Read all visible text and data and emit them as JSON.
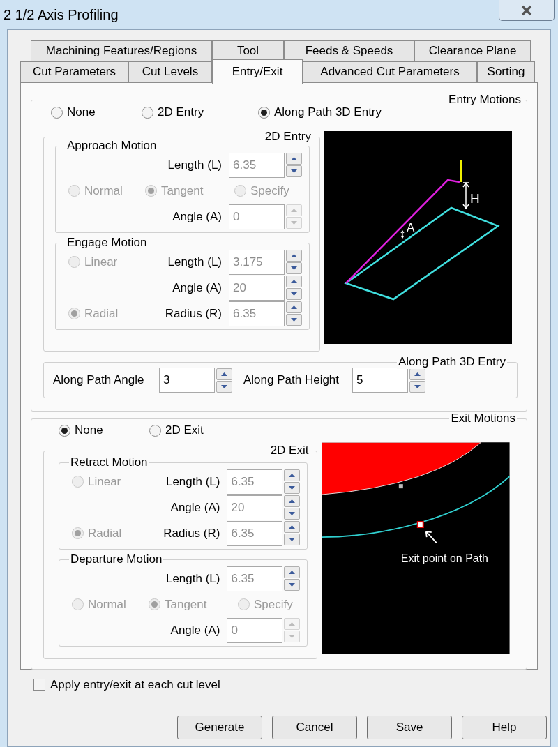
{
  "window": {
    "title": "2 1/2 Axis Profiling"
  },
  "tab_rows": [
    [
      {
        "label": "Machining Features/Regions",
        "selected": false
      },
      {
        "label": "Tool",
        "selected": false
      },
      {
        "label": "Feeds & Speeds",
        "selected": false
      },
      {
        "label": "Clearance Plane",
        "selected": false
      }
    ],
    [
      {
        "label": "Cut Parameters",
        "selected": false
      },
      {
        "label": "Cut Levels",
        "selected": false
      },
      {
        "label": "Entry/Exit",
        "selected": true
      },
      {
        "label": "Advanced Cut Parameters",
        "selected": false
      },
      {
        "label": "Sorting",
        "selected": false
      }
    ]
  ],
  "entry_motions": {
    "title": "Entry Motions",
    "options": [
      {
        "label": "None",
        "selected": false
      },
      {
        "label": "2D Entry",
        "selected": false
      },
      {
        "label": "Along Path 3D Entry",
        "selected": true
      }
    ],
    "entry_2d": {
      "title": "2D Entry",
      "disabled": true,
      "groups": [
        {
          "title": "Approach Motion",
          "rows": [
            {
              "kind": "field",
              "label": "Length (L)",
              "value": "6.35",
              "spin_disabled": false
            },
            {
              "kind": "radios",
              "options": [
                {
                  "label": "Normal",
                  "selected": false
                },
                {
                  "label": "Tangent",
                  "selected": true
                },
                {
                  "label": "Specify",
                  "selected": false
                }
              ]
            },
            {
              "kind": "field",
              "label": "Angle (A)",
              "value": "0",
              "spin_disabled": true
            }
          ]
        },
        {
          "title": "Engage Motion",
          "rows": [
            {
              "kind": "field",
              "radio": {
                "label": "Linear",
                "selected": false
              },
              "label": "Length (L)",
              "value": "3.175",
              "spin_disabled": false
            },
            {
              "kind": "field",
              "label": "Angle (A)",
              "value": "20",
              "spin_disabled": false
            },
            {
              "kind": "field",
              "radio": {
                "label": "Radial",
                "selected": true
              },
              "label": "Radius (R)",
              "value": "6.35",
              "spin_disabled": false
            }
          ]
        }
      ]
    },
    "diagram": {
      "height_label": "H",
      "angle_label": "A"
    },
    "along_path": {
      "title": "Along Path 3D Entry",
      "fields": [
        {
          "label": "Along Path Angle",
          "value": "3"
        },
        {
          "label": "Along Path Height",
          "value": "5"
        }
      ]
    }
  },
  "exit_motions": {
    "title": "Exit Motions",
    "options": [
      {
        "label": "None",
        "selected": true
      },
      {
        "label": "2D Exit",
        "selected": false
      }
    ],
    "exit_2d": {
      "title": "2D Exit",
      "disabled": true,
      "groups": [
        {
          "title": "Retract Motion",
          "rows": [
            {
              "kind": "field",
              "radio": {
                "label": "Linear",
                "selected": false
              },
              "label": "Length (L)",
              "value": "6.35",
              "spin_disabled": false
            },
            {
              "kind": "field",
              "label": "Angle (A)",
              "value": "20",
              "spin_disabled": false
            },
            {
              "kind": "field",
              "radio": {
                "label": "Radial",
                "selected": true
              },
              "label": "Radius (R)",
              "value": "6.35",
              "spin_disabled": false
            }
          ]
        },
        {
          "title": "Departure Motion",
          "rows": [
            {
              "kind": "field",
              "label": "Length (L)",
              "value": "6.35",
              "spin_disabled": false
            },
            {
              "kind": "radios",
              "options": [
                {
                  "label": "Normal",
                  "selected": false
                },
                {
                  "label": "Tangent",
                  "selected": true
                },
                {
                  "label": "Specify",
                  "selected": false
                }
              ]
            },
            {
              "kind": "field",
              "label": "Angle (A)",
              "value": "0",
              "spin_disabled": true
            }
          ]
        }
      ]
    },
    "diagram": {
      "caption": "Exit point on Path"
    }
  },
  "apply_each_level": {
    "label": "Apply entry/exit at each cut level",
    "checked": false
  },
  "buttons": [
    "Generate",
    "Cancel",
    "Save",
    "Help"
  ]
}
